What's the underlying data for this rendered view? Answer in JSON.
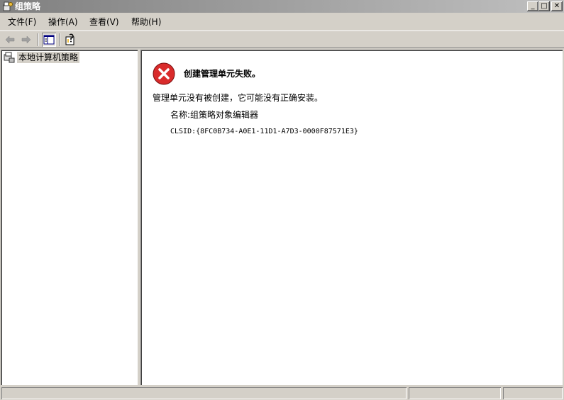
{
  "window": {
    "title": "组策略",
    "min_icon": "_",
    "max_icon": "□",
    "close_icon": "✕"
  },
  "menu": {
    "items": [
      {
        "label": "文件(F)"
      },
      {
        "label": "操作(A)"
      },
      {
        "label": "查看(V)"
      },
      {
        "label": "帮助(H)"
      }
    ]
  },
  "toolbar": {
    "icons": [
      "back-arrow-icon",
      "forward-arrow-icon",
      "show-hide-tree-icon",
      "help-icon"
    ]
  },
  "tree": {
    "root_label": "本地计算机策略"
  },
  "error": {
    "title": "创建管理单元失败。",
    "message": "管理单元没有被创建，它可能没有正确安装。",
    "name_line": "名称:组策略对象编辑器",
    "clsid_line": "CLSID:{8FC0B734-A0E1-11D1-A7D3-0000F87571E3}",
    "icon_color": "#d92b2b"
  }
}
